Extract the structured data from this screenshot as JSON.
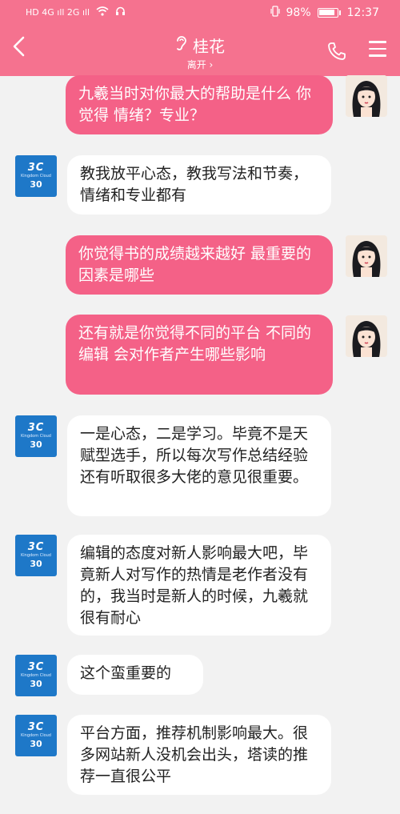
{
  "status_bar": {
    "left_signal": "HD 4G ıll 2G ıll",
    "battery_percent": "98%",
    "time": "12:37"
  },
  "header": {
    "back_icon": "chevron-left-icon",
    "title": "桂花",
    "subtitle": "离开 ›",
    "ear_icon": "ear-icon",
    "phone_icon": "phone-icon",
    "menu_icon": "menu-icon"
  },
  "colors": {
    "header": "#f5728f",
    "outgoing_bubble": "#f46187",
    "incoming_bubble": "#ffffff",
    "background": "#f2f2f2"
  },
  "avatar_logo": {
    "line1": "3C",
    "line2": "Kingdom Cloud",
    "line3": "30"
  },
  "messages": [
    {
      "side": "out",
      "text": "九羲当时对你最大的帮助是什么 你觉得 情绪？专业？"
    },
    {
      "side": "in",
      "text": "教我放平心态，教我写法和节奏，情绪和专业都有"
    },
    {
      "side": "out",
      "text": "你觉得书的成绩越来越好 最重要的因素是哪些"
    },
    {
      "side": "out",
      "text": "还有就是你觉得不同的平台 不同的编辑 会对作者产生哪些影响"
    },
    {
      "side": "in",
      "text": "一是心态，二是学习。毕竟不是天赋型选手，所以每次写作总结经验还有听取很多大佬的意见很重要。"
    },
    {
      "side": "in",
      "text": "编辑的态度对新人影响最大吧，毕竟新人对写作的热情是老作者没有的，我当时是新人的时候，九羲就很有耐心"
    },
    {
      "side": "in",
      "text": "这个蛮重要的"
    },
    {
      "side": "in",
      "text": "平台方面，推荐机制影响最大。很多网站新人没机会出头，塔读的推荐一直很公平"
    }
  ]
}
